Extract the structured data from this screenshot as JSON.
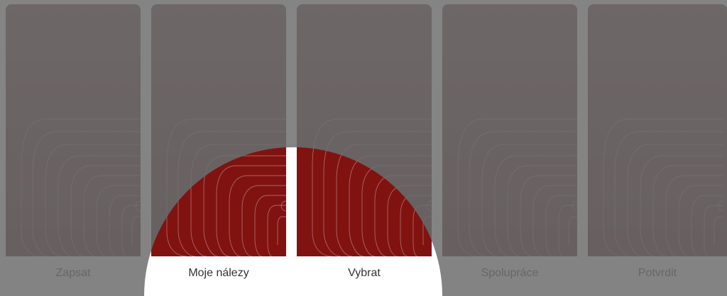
{
  "cards": [
    {
      "label": "Zapsat"
    },
    {
      "label": "Moje nálezy"
    },
    {
      "label": "Vybrat"
    },
    {
      "label": "Spolupráce"
    },
    {
      "label": "Potvrdit"
    }
  ],
  "colors": {
    "card_art": "#3d0505",
    "spotlight_red": "#8a1612",
    "overlay": "#737373",
    "label_text": "#333333"
  }
}
